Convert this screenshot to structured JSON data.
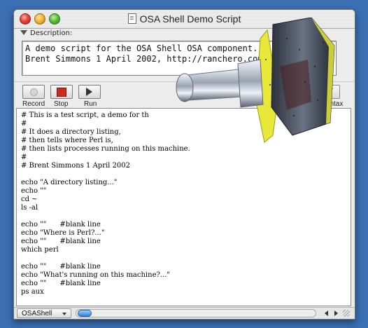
{
  "window": {
    "title": "OSA Shell Demo Script"
  },
  "description": {
    "header_label": "Description:",
    "text": "A demo script for the OSA Shell OSA component.\nBrent Simmons 1 April 2002, http://ranchero.com/so                        /"
  },
  "toolbar": {
    "record_label": "Record",
    "stop_label": "Stop",
    "run_label": "Run",
    "check_syntax_label": "k Syntax",
    "check_syntax_symbol": "✓"
  },
  "editor": {
    "code": "# This is a test script, a demo for th\n#\n# It does a directory listing,\n# then tells where Perl is,\n# then lists processes running on this machine.\n#\n# Brent Simmons 1 April 2002\n\necho \"A directory listing...\"\necho \"\"\ncd ~\nls -al\n\necho \"\"      #blank line\necho \"Where is Perl?...\"\necho \"\"      #blank line\nwhich perl\n\necho \"\"      #blank line\necho \"What's running on this machine?...\"\necho \"\"      #blank line\nps aux"
  },
  "statusbar": {
    "language_popup": "OSAShell"
  },
  "colors": {
    "desktop": "#3b6fb4",
    "stop_red": "#cf2a1c",
    "overlay_yellow": "#e8e83a",
    "overlay_metal_dark": "#3a3f4a"
  },
  "icons": [
    "close-light",
    "minimize-light",
    "zoom-light",
    "document-icon",
    "disclosure-triangle-icon",
    "record-icon",
    "stop-icon",
    "run-icon",
    "check-syntax-icon",
    "popup-arrow-icon",
    "scroll-left-icon",
    "scroll-right-icon",
    "grow-box-icon",
    "osa-component-icon"
  ]
}
